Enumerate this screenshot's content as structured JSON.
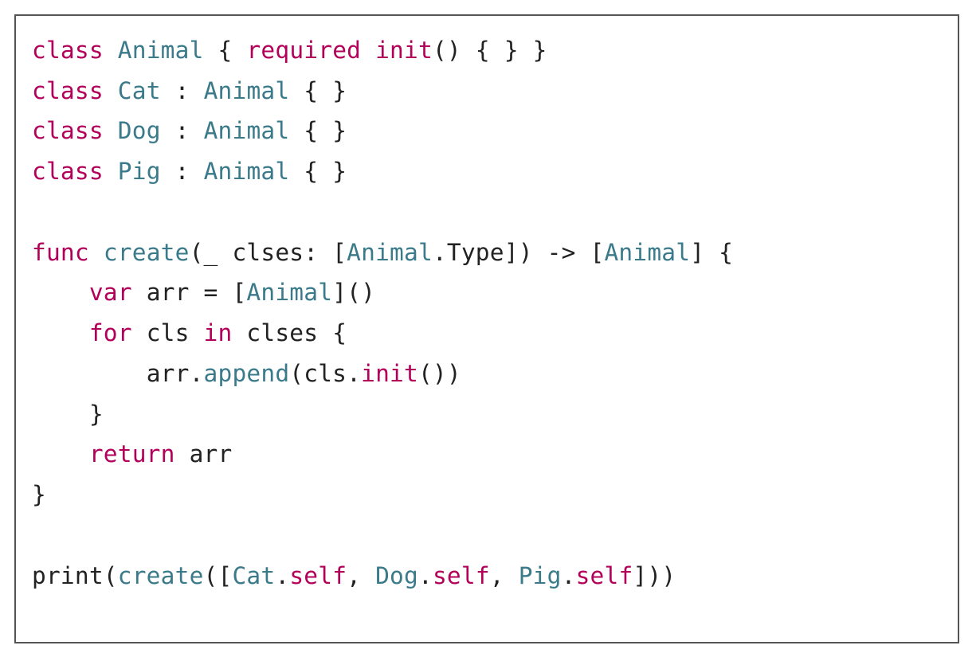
{
  "code": {
    "line1": {
      "kw_class": "class",
      "name": "Animal",
      "brace_open": " { ",
      "kw_required": "required",
      "sp1": " ",
      "kw_init": "init",
      "rest": "() { } }"
    },
    "line2": {
      "kw_class": "class",
      "name": "Cat",
      "colon": " : ",
      "base": "Animal",
      "rest": " { }"
    },
    "line3": {
      "kw_class": "class",
      "name": "Dog",
      "colon": " : ",
      "base": "Animal",
      "rest": " { }"
    },
    "line4": {
      "kw_class": "class",
      "name": "Pig",
      "colon": " : ",
      "base": "Animal",
      "rest": " { }"
    },
    "line6": {
      "kw_func": "func",
      "sp": " ",
      "fn": "create",
      "sig1": "(_ clses: [",
      "t1": "Animal",
      "sig2": ".",
      "t2": "Type",
      "sig3": "]) -> [",
      "t3": "Animal",
      "sig4": "] {"
    },
    "line7": {
      "indent": "    ",
      "kw_var": "var",
      "mid": " arr = [",
      "t": "Animal",
      "rest": "]()"
    },
    "line8": {
      "indent": "    ",
      "kw_for": "for",
      "mid1": " cls ",
      "kw_in": "in",
      "mid2": " clses {"
    },
    "line9": {
      "indent": "        ",
      "pre": "arr.",
      "fn1": "append",
      "mid": "(cls.",
      "fn2": "init",
      "rest": "())"
    },
    "line10": {
      "indent": "    ",
      "txt": "}"
    },
    "line11": {
      "indent": "    ",
      "kw_return": "return",
      "rest": " arr"
    },
    "line12": {
      "txt": "}"
    },
    "line14": {
      "pre": "print(",
      "fn": "create",
      "mid1": "([",
      "t1": "Cat",
      "dot1": ".",
      "p1": "self",
      "c1": ", ",
      "t2": "Dog",
      "dot2": ".",
      "p2": "self",
      "c2": ", ",
      "t3": "Pig",
      "dot3": ".",
      "p3": "self",
      "rest": "]))"
    }
  }
}
